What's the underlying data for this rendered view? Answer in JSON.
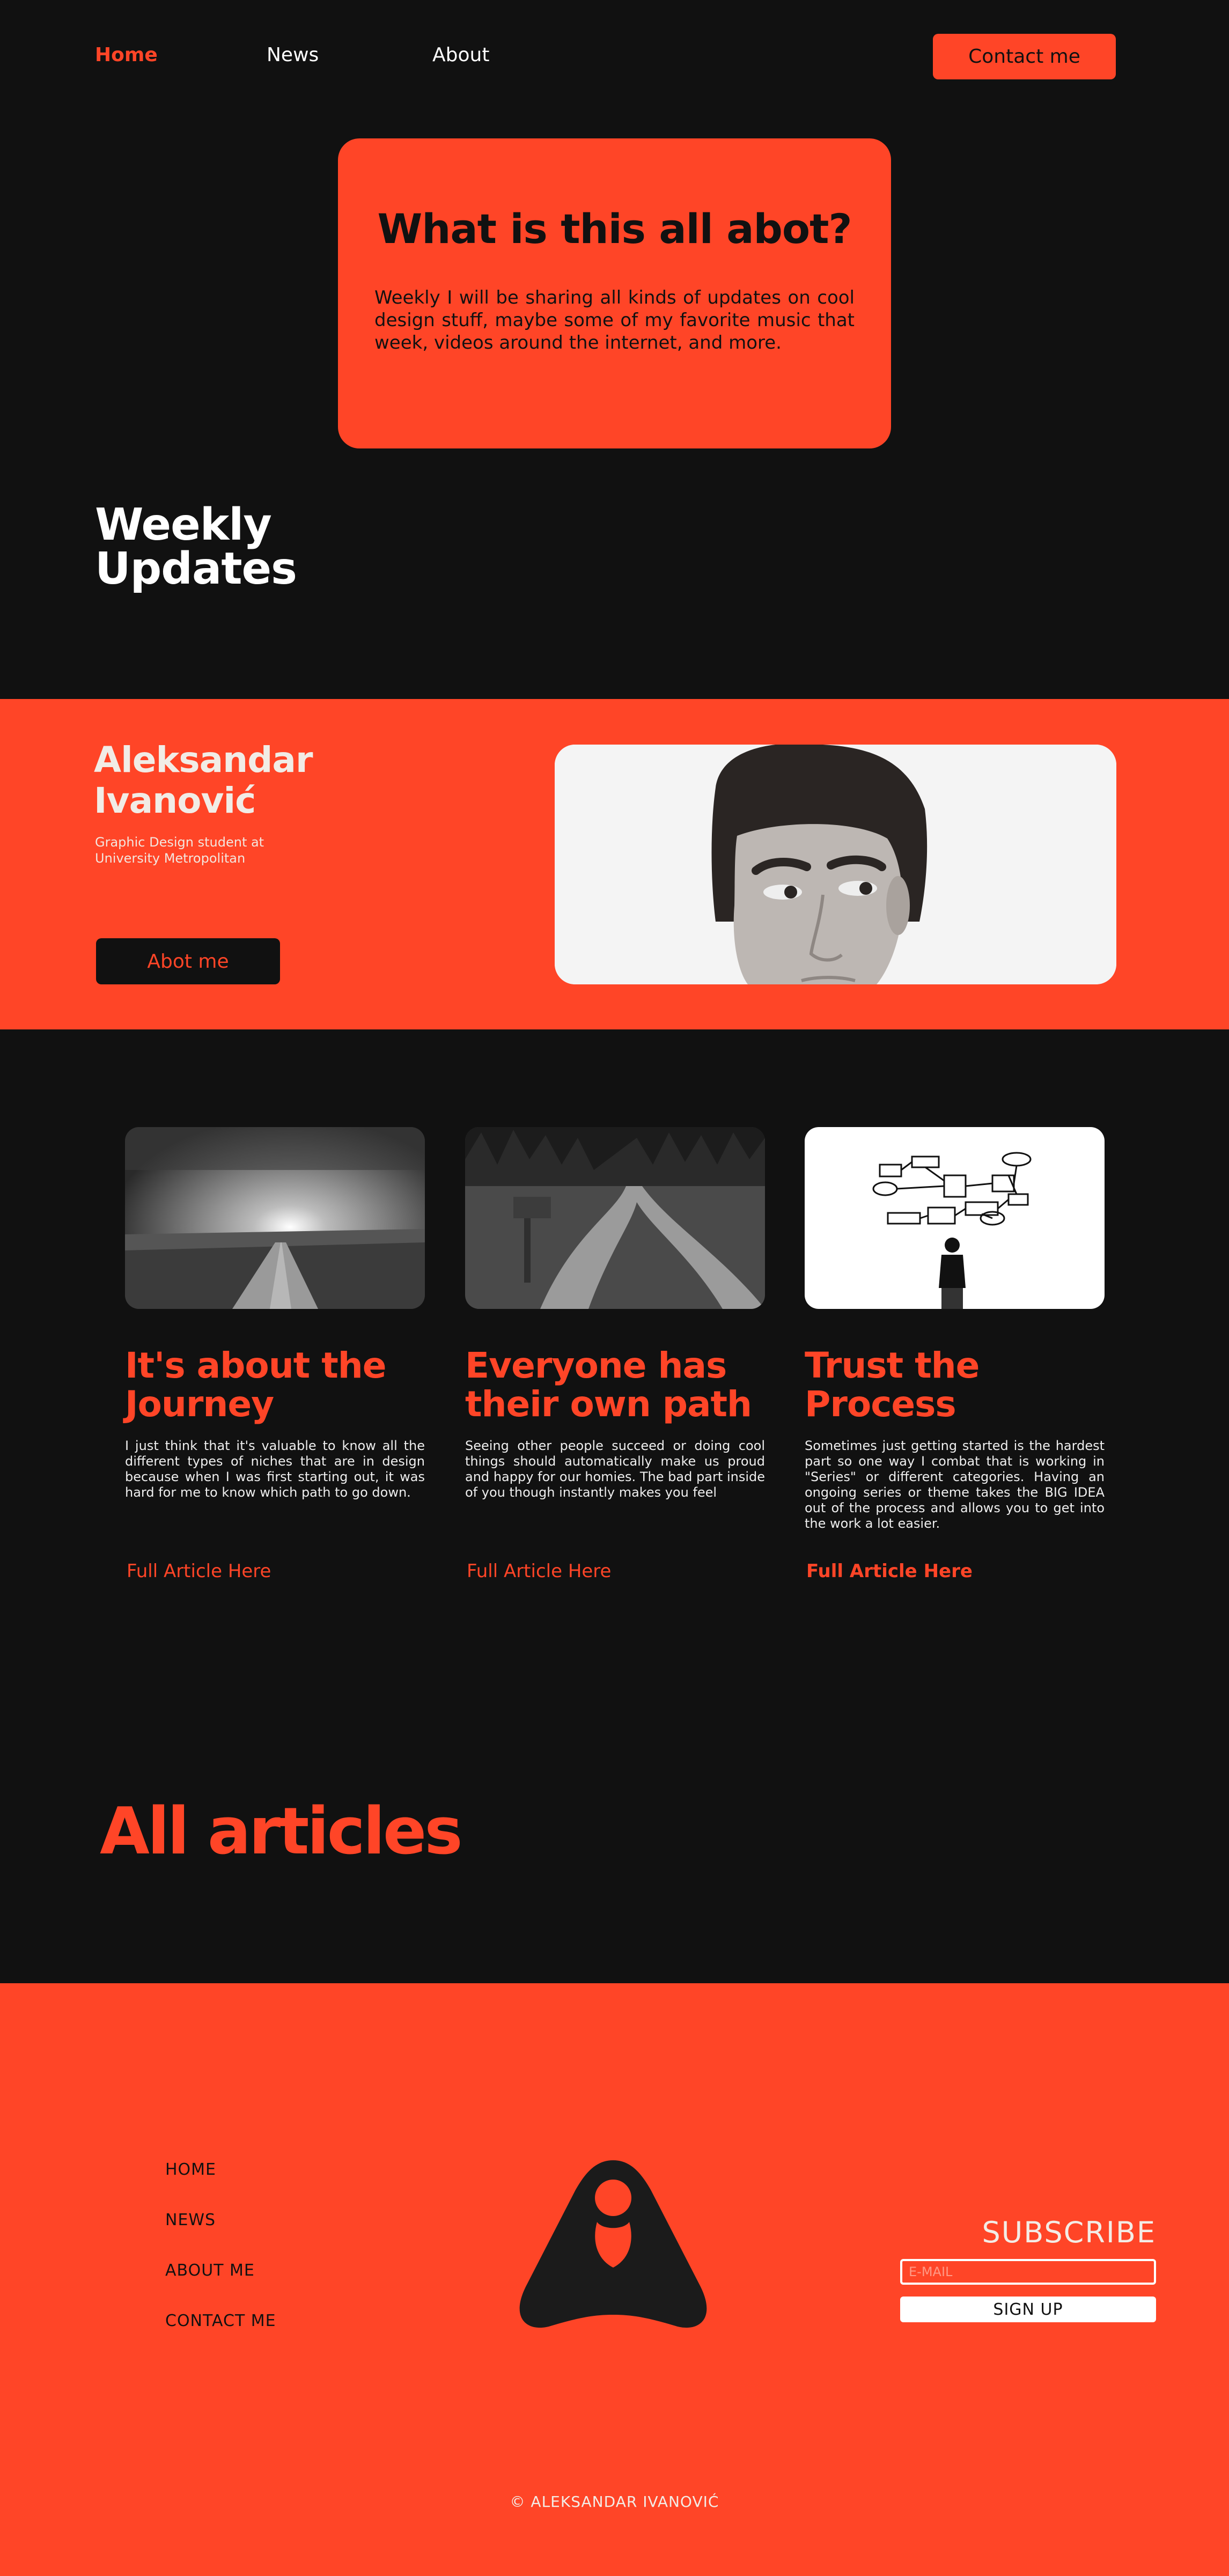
{
  "nav": {
    "home": "Home",
    "news": "News",
    "about": "About",
    "contact": "Contact me"
  },
  "hero": {
    "title": "What is this all abot?",
    "text": "Weekly I will be sharing all kinds of updates on cool design stuff, maybe some of my favorite music that week, videos around the internet, and more."
  },
  "weekly": {
    "line1": "Weekly",
    "line2": "Updates"
  },
  "profile": {
    "first_name": "Aleksandar",
    "last_name": "Ivanović",
    "sub_line1": "Graphic Design student at",
    "sub_line2": "University Metropolitan",
    "button": "Abot me"
  },
  "articles": [
    {
      "title_line1": "It's about the",
      "title_line2": "Journey",
      "text": "I just think that it's valuable to know all the different types of niches that are in design because when I was first starting out, it was hard for me to know which path to go down.",
      "link": "Full Article Here"
    },
    {
      "title_line1": "Everyone has",
      "title_line2": "their own path",
      "text": "Seeing other people succeed or doing cool things should automatically make us proud and happy for our homies. The bad part inside of you though instantly makes you feel",
      "link": "Full Article Here"
    },
    {
      "title_line1": "Trust the",
      "title_line2": "Process",
      "text": "Sometimes just getting started is the hardest part so one way I combat that is working in \"Series\" or different categories. Having an ongoing series or theme takes the BIG IDEA out of the process and allows you to get into the work a lot easier.",
      "link": "Full Article Here"
    }
  ],
  "all_articles": "All articles",
  "footer": {
    "links": [
      "HOME",
      "NEWS",
      "ABOUT ME",
      "CONTACT ME"
    ],
    "subscribe_title": "SUBSCRIBE",
    "email_placeholder": "E-MAIL",
    "signup": "SIGN UP",
    "copyright": "© ALEKSANDAR IVANOVIĆ"
  },
  "colors": {
    "background": "#111111",
    "accent": "#ff4527",
    "text_light": "#ffffff"
  }
}
